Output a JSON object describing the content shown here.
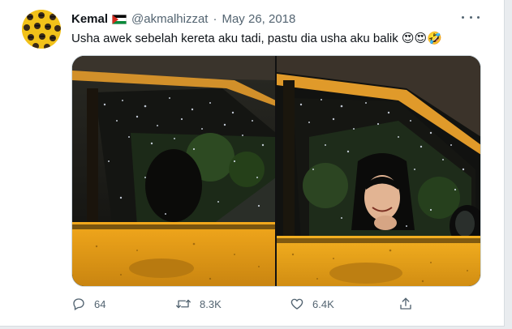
{
  "tweet": {
    "author_name": "Kemal",
    "author_flag": "palestine-flag-icon",
    "handle": "@akmalhizzat",
    "separator": "·",
    "date": "May 26, 2018",
    "text": "Usha awek sebelah kereta aku tadi, pastu dia usha aku balik 😍😍🤣"
  },
  "media": [
    {
      "icon": "photo-car-window-rain-left"
    },
    {
      "icon": "photo-car-window-girl-smiling-right"
    }
  ],
  "actions": {
    "reply_count": "64",
    "retweet_count": "8.3K",
    "like_count": "6.4K"
  },
  "colors": {
    "text_primary": "#0f1419",
    "text_secondary": "#536471",
    "border": "#cfd9de",
    "avatar_bg": "#f2c21a",
    "taxi_yellow": "#f0a91e"
  }
}
